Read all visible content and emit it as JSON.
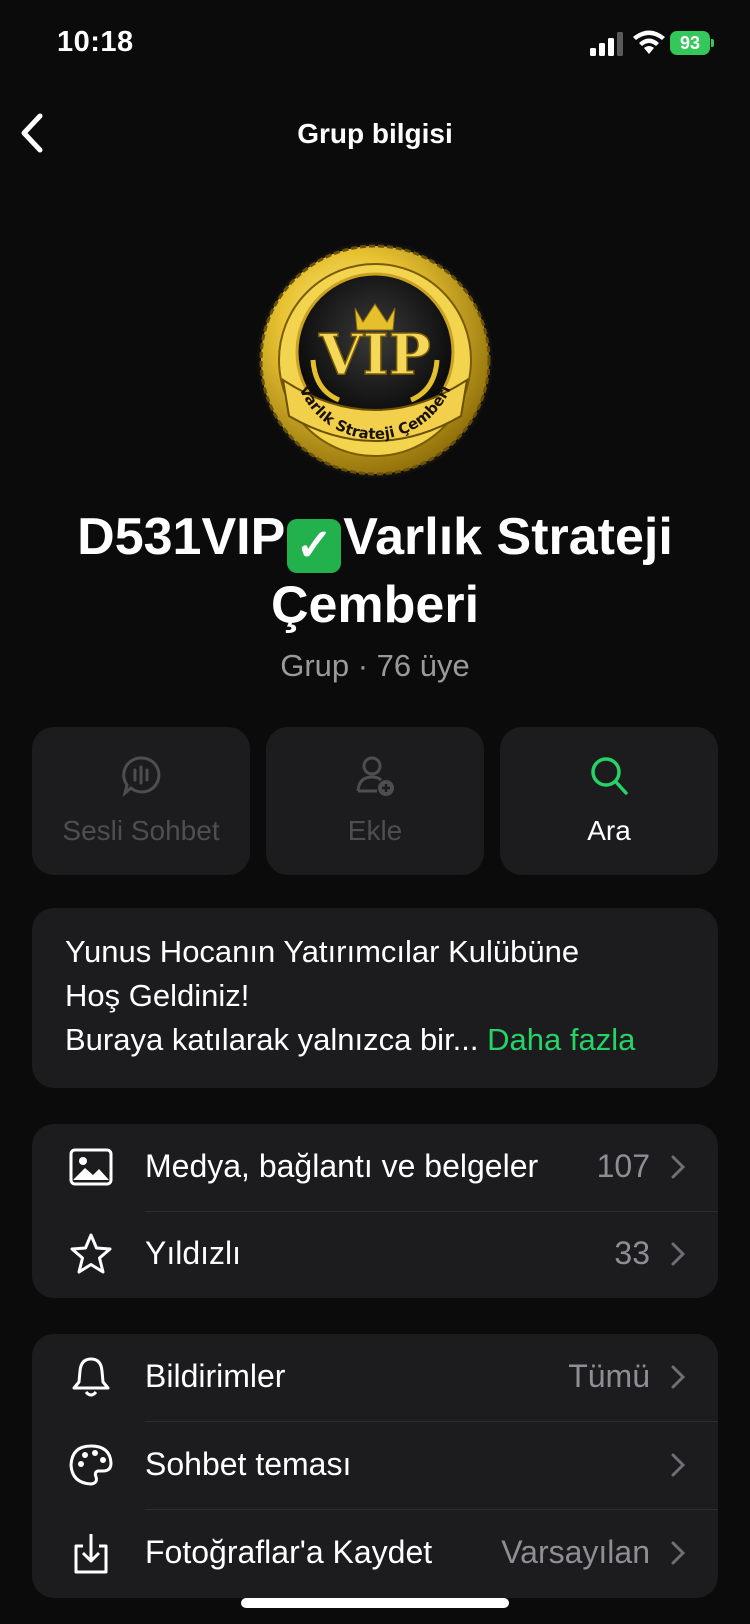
{
  "status_bar": {
    "time": "10:18",
    "battery": "93"
  },
  "nav": {
    "title": "Grup bilgisi"
  },
  "group": {
    "name_part1": "D531VIP",
    "name_part2": "Varlık Strateji Çemberi",
    "subtitle": "Grup · 76 üye",
    "badge_text": "Varlık Strateji Çemberi",
    "badge_vip": "VIP"
  },
  "actions": [
    {
      "label": "Sesli Sohbet",
      "icon": "voice-chat-icon",
      "enabled": false
    },
    {
      "label": "Ekle",
      "icon": "add-person-icon",
      "enabled": false
    },
    {
      "label": "Ara",
      "icon": "search-icon",
      "enabled": true
    }
  ],
  "description": {
    "line1": "Yunus Hocanın Yatırımcılar Kulübüne",
    "line2": "Hoş Geldiniz!",
    "line3": "Buraya katılarak yalnızca bir...",
    "more": "Daha fazla"
  },
  "section1": [
    {
      "label": "Medya, bağlantı ve belgeler",
      "value": "107",
      "icon": "image-icon"
    },
    {
      "label": "Yıldızlı",
      "value": "33",
      "icon": "star-icon"
    }
  ],
  "section2": [
    {
      "label": "Bildirimler",
      "value": "Tümü",
      "icon": "bell-icon"
    },
    {
      "label": "Sohbet teması",
      "value": "",
      "icon": "palette-icon"
    },
    {
      "label": "Fotoğraflar'a Kaydet",
      "value": "Varsayılan",
      "icon": "save-download-icon"
    }
  ],
  "colors": {
    "accent": "#25d366",
    "background": "#0b0b0b",
    "card": "#1c1c1e",
    "battery": "#34c759"
  }
}
